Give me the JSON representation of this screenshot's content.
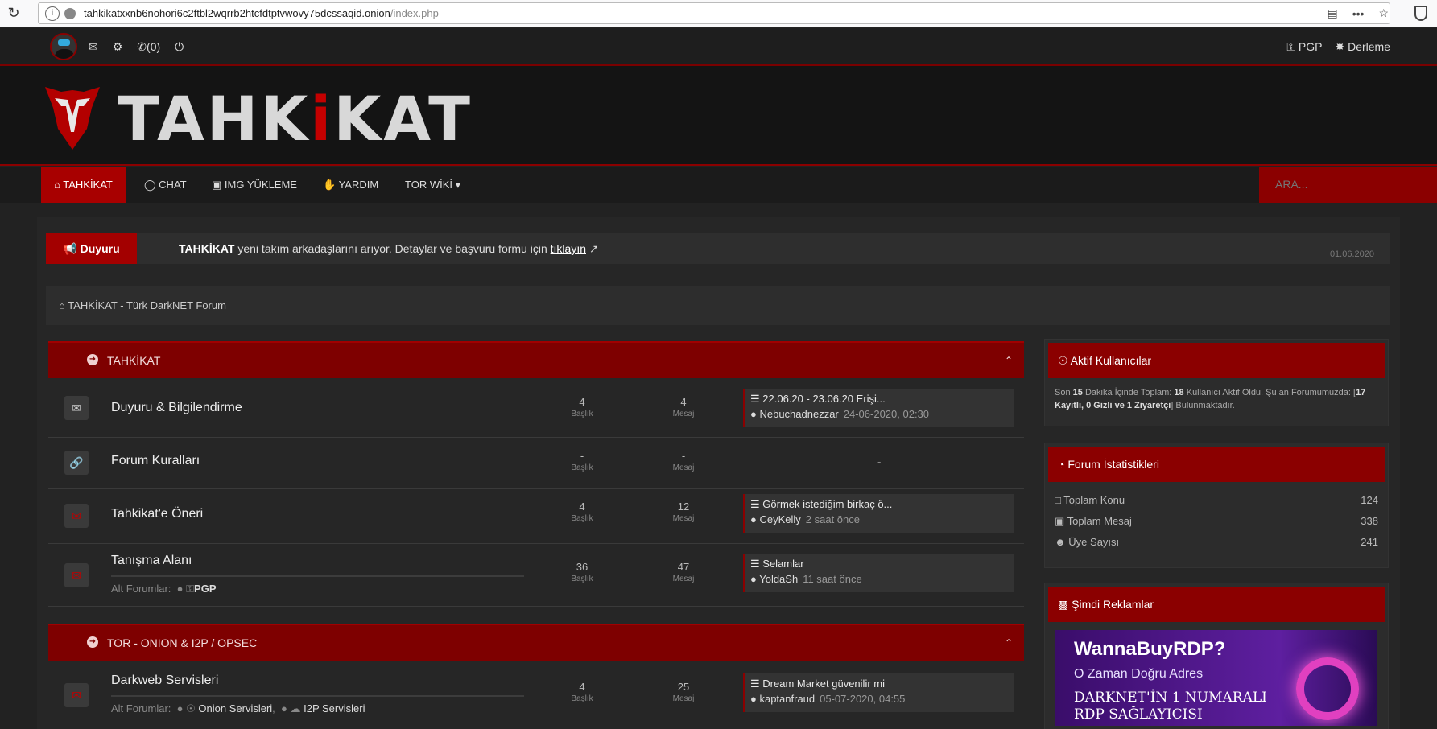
{
  "browser": {
    "url_host": "tahkikatxxnb6nohori6c2ftbl2wqrrb2htcfdtptvwovy75dcssaqid.onion",
    "url_path": "/index.php",
    "menu_dots": "•••",
    "star": "☆"
  },
  "topbar": {
    "notif_count": "(0)",
    "pgp_label": "PGP",
    "derleme_label": "Derleme"
  },
  "logo": {
    "text_a": "TAHK",
    "text_b": "i",
    "text_c": "KAT"
  },
  "nav": {
    "items": [
      "TAHKİKAT",
      "CHAT",
      "IMG YÜKLEME",
      "YARDIM",
      "TOR WİKİ"
    ],
    "search_placeholder": "ARA..."
  },
  "announcement": {
    "badge": "Duyuru",
    "brand": "TAHKİKAT",
    "text": " yeni takım arkadaşlarını arıyor. Detaylar ve başvuru formu için ",
    "link": "tıklayın",
    "date": "01.06.2020"
  },
  "breadcrumb": "TAHKİKAT - Türk DarkNET Forum",
  "categories": [
    {
      "title": "TAHKİKAT"
    },
    {
      "title": "TOR - ONION & I2P / OPSEC"
    }
  ],
  "forums": [
    {
      "name": "Duyuru & Bilgilendirme",
      "topics": "4",
      "topics_label": "Başlık",
      "posts": "4",
      "posts_label": "Mesaj",
      "last_title": "22.06.20 - 23.06.20 Erişi...",
      "last_user": "Nebuchadnezzar",
      "last_time": "24-06-2020, 02:30"
    },
    {
      "name": "Forum Kuralları",
      "topics": "-",
      "topics_label": "Başlık",
      "posts": "-",
      "posts_label": "Mesaj",
      "last_dash": "-"
    },
    {
      "name": "Tahkikat'e Öneri",
      "topics": "4",
      "topics_label": "Başlık",
      "posts": "12",
      "posts_label": "Mesaj",
      "last_title": "Görmek istediğim birkaç ö...",
      "last_user": "CeyKelly",
      "last_time": "2 saat önce"
    },
    {
      "name": "Tanışma Alanı",
      "subs_label": "Alt Forumlar:",
      "subs": [
        "PGP"
      ],
      "topics": "36",
      "topics_label": "Başlık",
      "posts": "47",
      "posts_label": "Mesaj",
      "last_title": "Selamlar",
      "last_user": "YoldaSh",
      "last_time": "11 saat önce"
    },
    {
      "name": "Darkweb Servisleri",
      "subs_label": "Alt Forumlar:",
      "subs": [
        "Onion Servisleri",
        "I2P Servisleri"
      ],
      "topics": "4",
      "topics_label": "Başlık",
      "posts": "25",
      "posts_label": "Mesaj",
      "last_title": "Dream Market güvenilir mi",
      "last_user": "kaptanfraud",
      "last_time": "05-07-2020, 04:55"
    }
  ],
  "sidebar": {
    "active": {
      "title": "Aktif Kullanıcılar",
      "p1": "Son ",
      "minutes": "15",
      "p2": " Dakika İçinde Toplam: ",
      "total": "18",
      "p3": " Kullanıcı Aktif Oldu. Şu an Forumumuzda: [",
      "breakdown": "17 Kayıtlı, 0 Gizli ve 1 Ziyaretçi",
      "p4": "] Bulunmaktadır."
    },
    "stats": {
      "title": "Forum İstatistikleri",
      "rows": [
        {
          "label": "Toplam Konu",
          "value": "124"
        },
        {
          "label": "Toplam Mesaj",
          "value": "338"
        },
        {
          "label": "Üye Sayısı",
          "value": "241"
        }
      ]
    },
    "ads": {
      "title": "Şimdi Reklamlar",
      "ad_title": "WannaBuyRDP?",
      "ad_line1": "O Zaman Doğru Adres",
      "ad_line2": "DARKNET'İN 1 NUMARALI",
      "ad_line3": "RDP SAĞLAYICISI"
    }
  }
}
